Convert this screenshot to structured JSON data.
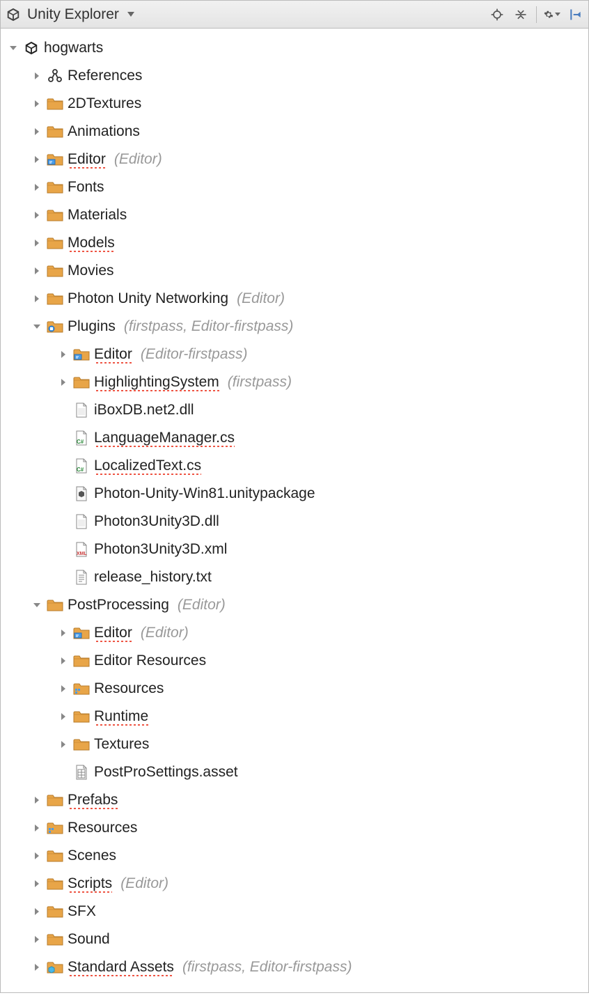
{
  "title": "Unity Explorer",
  "tree": [
    {
      "indent": 0,
      "arrow": "down",
      "icon": "unity",
      "label": "hogwarts",
      "spell": false,
      "suffix": ""
    },
    {
      "indent": 1,
      "arrow": "right",
      "icon": "references",
      "label": "References",
      "spell": false,
      "suffix": ""
    },
    {
      "indent": 1,
      "arrow": "right",
      "icon": "folder",
      "label": "2DTextures",
      "spell": false,
      "suffix": ""
    },
    {
      "indent": 1,
      "arrow": "right",
      "icon": "folder",
      "label": "Animations",
      "spell": false,
      "suffix": ""
    },
    {
      "indent": 1,
      "arrow": "right",
      "icon": "folder-editor",
      "label": "Editor",
      "spell": true,
      "suffix": "(Editor)"
    },
    {
      "indent": 1,
      "arrow": "right",
      "icon": "folder",
      "label": "Fonts",
      "spell": false,
      "suffix": ""
    },
    {
      "indent": 1,
      "arrow": "right",
      "icon": "folder",
      "label": "Materials",
      "spell": false,
      "suffix": ""
    },
    {
      "indent": 1,
      "arrow": "right",
      "icon": "folder",
      "label": "Models",
      "spell": true,
      "suffix": ""
    },
    {
      "indent": 1,
      "arrow": "right",
      "icon": "folder",
      "label": "Movies",
      "spell": false,
      "suffix": ""
    },
    {
      "indent": 1,
      "arrow": "right",
      "icon": "folder",
      "label": "Photon Unity Networking",
      "spell": false,
      "suffix": "(Editor)"
    },
    {
      "indent": 1,
      "arrow": "down",
      "icon": "folder-plugins",
      "label": "Plugins",
      "spell": false,
      "suffix": "(firstpass, Editor-firstpass)"
    },
    {
      "indent": 2,
      "arrow": "right",
      "icon": "folder-editor",
      "label": "Editor",
      "spell": true,
      "suffix": "(Editor-firstpass)"
    },
    {
      "indent": 2,
      "arrow": "right",
      "icon": "folder",
      "label": "HighlightingSystem",
      "spell": true,
      "suffix": "(firstpass)"
    },
    {
      "indent": 2,
      "arrow": "none",
      "icon": "file-dll",
      "label": "iBoxDB.net2.dll",
      "spell": false,
      "suffix": ""
    },
    {
      "indent": 2,
      "arrow": "none",
      "icon": "file-cs",
      "label": "LanguageManager.cs",
      "spell": true,
      "suffix": ""
    },
    {
      "indent": 2,
      "arrow": "none",
      "icon": "file-cs",
      "label": "LocalizedText.cs",
      "spell": true,
      "suffix": ""
    },
    {
      "indent": 2,
      "arrow": "none",
      "icon": "file-unity",
      "label": "Photon-Unity-Win81.unitypackage",
      "spell": false,
      "suffix": ""
    },
    {
      "indent": 2,
      "arrow": "none",
      "icon": "file-dll",
      "label": "Photon3Unity3D.dll",
      "spell": false,
      "suffix": ""
    },
    {
      "indent": 2,
      "arrow": "none",
      "icon": "file-xml",
      "label": "Photon3Unity3D.xml",
      "spell": false,
      "suffix": ""
    },
    {
      "indent": 2,
      "arrow": "none",
      "icon": "file-txt",
      "label": "release_history.txt",
      "spell": false,
      "suffix": ""
    },
    {
      "indent": 1,
      "arrow": "down",
      "icon": "folder",
      "label": "PostProcessing",
      "spell": false,
      "suffix": "(Editor)"
    },
    {
      "indent": 2,
      "arrow": "right",
      "icon": "folder-editor",
      "label": "Editor",
      "spell": true,
      "suffix": "(Editor)"
    },
    {
      "indent": 2,
      "arrow": "right",
      "icon": "folder",
      "label": "Editor Resources",
      "spell": false,
      "suffix": ""
    },
    {
      "indent": 2,
      "arrow": "right",
      "icon": "folder-resources",
      "label": "Resources",
      "spell": false,
      "suffix": ""
    },
    {
      "indent": 2,
      "arrow": "right",
      "icon": "folder",
      "label": "Runtime",
      "spell": true,
      "suffix": ""
    },
    {
      "indent": 2,
      "arrow": "right",
      "icon": "folder",
      "label": "Textures",
      "spell": false,
      "suffix": ""
    },
    {
      "indent": 2,
      "arrow": "none",
      "icon": "file-asset",
      "label": "PostProSettings.asset",
      "spell": false,
      "suffix": ""
    },
    {
      "indent": 1,
      "arrow": "right",
      "icon": "folder",
      "label": "Prefabs",
      "spell": true,
      "suffix": ""
    },
    {
      "indent": 1,
      "arrow": "right",
      "icon": "folder-resources",
      "label": "Resources",
      "spell": false,
      "suffix": ""
    },
    {
      "indent": 1,
      "arrow": "right",
      "icon": "folder",
      "label": "Scenes",
      "spell": false,
      "suffix": ""
    },
    {
      "indent": 1,
      "arrow": "right",
      "icon": "folder",
      "label": "Scripts",
      "spell": true,
      "suffix": "(Editor)"
    },
    {
      "indent": 1,
      "arrow": "right",
      "icon": "folder",
      "label": "SFX",
      "spell": false,
      "suffix": ""
    },
    {
      "indent": 1,
      "arrow": "right",
      "icon": "folder",
      "label": "Sound",
      "spell": false,
      "suffix": ""
    },
    {
      "indent": 1,
      "arrow": "right",
      "icon": "folder-asset",
      "label": "Standard Assets",
      "spell": true,
      "suffix": "(firstpass, Editor-firstpass)"
    }
  ]
}
